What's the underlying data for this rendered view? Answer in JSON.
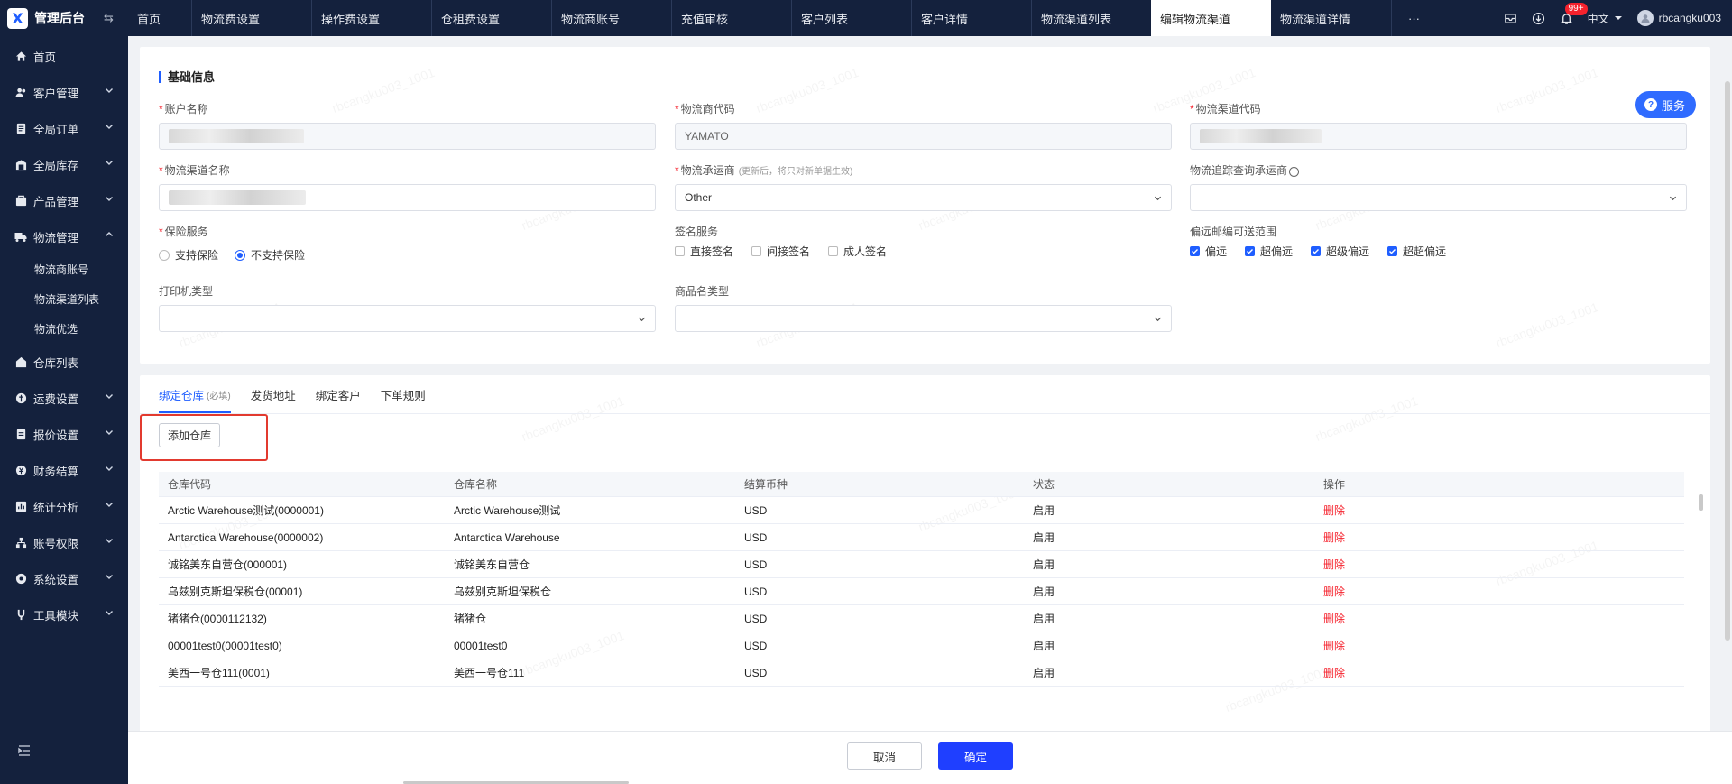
{
  "app": {
    "title": "管理后台",
    "logo_letter": "X"
  },
  "tabs": [
    "首页",
    "物流费设置",
    "操作费设置",
    "仓租费设置",
    "物流商账号",
    "充值审核",
    "客户列表",
    "客户详情",
    "物流渠道列表",
    "编辑物流渠道",
    "物流渠道详情"
  ],
  "tabs_more": "···",
  "topbar": {
    "badge": "99+",
    "lang": "中文",
    "username": "rbcangku003"
  },
  "sidebar": {
    "items": [
      {
        "label": "首页",
        "icon": "home-icon"
      },
      {
        "label": "客户管理",
        "icon": "users-icon"
      },
      {
        "label": "全局订单",
        "icon": "orders-icon"
      },
      {
        "label": "全局库存",
        "icon": "inventory-icon"
      },
      {
        "label": "产品管理",
        "icon": "product-icon"
      },
      {
        "label": "物流管理",
        "icon": "truck-icon"
      }
    ],
    "sub_items": [
      "物流商账号",
      "物流渠道列表",
      "物流优选"
    ],
    "items2": [
      {
        "label": "仓库列表",
        "icon": "warehouse-icon"
      },
      {
        "label": "运费设置",
        "icon": "freight-icon"
      },
      {
        "label": "报价设置",
        "icon": "quote-icon"
      },
      {
        "label": "财务结算",
        "icon": "finance-icon"
      },
      {
        "label": "统计分析",
        "icon": "chart-icon"
      },
      {
        "label": "账号权限",
        "icon": "permission-icon"
      },
      {
        "label": "系统设置",
        "icon": "settings-icon"
      },
      {
        "label": "工具模块",
        "icon": "tools-icon"
      }
    ]
  },
  "basic": {
    "title": "基础信息",
    "service_btn": "服务",
    "account_name": {
      "label": "账户名称"
    },
    "carrier_code": {
      "label": "物流商代码",
      "value": "YAMATO"
    },
    "channel_code": {
      "label": "物流渠道代码"
    },
    "channel_name": {
      "label": "物流渠道名称"
    },
    "carrier": {
      "label": "物流承运商",
      "hint": "(更新后，将只对新单据生效)",
      "value": "Other"
    },
    "tracking_carrier": {
      "label": "物流追踪查询承运商",
      "info": "i"
    },
    "insurance": {
      "label": "保险服务",
      "options": [
        "支持保险",
        "不支持保险"
      ]
    },
    "signature": {
      "label": "签名服务",
      "options": [
        "直接签名",
        "间接签名",
        "成人签名"
      ]
    },
    "remote": {
      "label": "偏远邮编可送范围",
      "options": [
        "偏远",
        "超偏远",
        "超级偏远",
        "超超偏远"
      ]
    },
    "printer_type": {
      "label": "打印机类型"
    },
    "goods_name_type": {
      "label": "商品名类型"
    }
  },
  "bind": {
    "tabs": [
      "绑定仓库",
      "发货地址",
      "绑定客户",
      "下单规则"
    ],
    "required_hint": "(必填)",
    "add_btn": "添加仓库",
    "columns": [
      "仓库代码",
      "仓库名称",
      "结算币种",
      "状态",
      "操作"
    ],
    "rows": [
      [
        "Arctic Warehouse测试(0000001)",
        "Arctic Warehouse测试",
        "USD",
        "启用",
        "删除"
      ],
      [
        "Antarctica Warehouse(0000002)",
        "Antarctica Warehouse",
        "USD",
        "启用",
        "删除"
      ],
      [
        "诚铭美东自营仓(000001)",
        "诚铭美东自营仓",
        "USD",
        "启用",
        "删除"
      ],
      [
        "乌兹别克斯坦保税仓(00001)",
        "乌兹别克斯坦保税仓",
        "USD",
        "启用",
        "删除"
      ],
      [
        "猪猪仓(0000112132)",
        "猪猪仓",
        "USD",
        "启用",
        "删除"
      ],
      [
        "00001test0(00001test0)",
        "00001test0",
        "USD",
        "启用",
        "删除"
      ],
      [
        "美西一号仓111(0001)",
        "美西一号仓111",
        "USD",
        "启用",
        "删除"
      ]
    ]
  },
  "footer": {
    "cancel": "取消",
    "ok": "确定"
  },
  "colors": {
    "sidebar": "#14213d",
    "accent": "#1f5eff",
    "danger": "#f5222d"
  }
}
